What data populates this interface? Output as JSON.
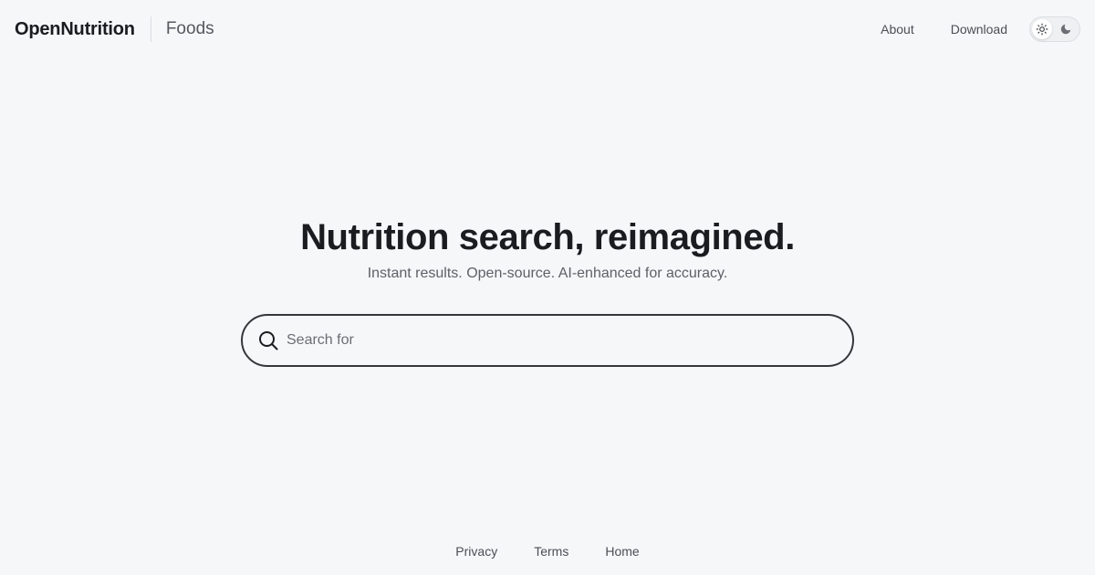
{
  "header": {
    "brand": "OpenNutrition",
    "section": "Foods",
    "nav": [
      {
        "label": "About"
      },
      {
        "label": "Download"
      }
    ],
    "theme_toggle": {
      "options": [
        "sun-icon",
        "moon-icon"
      ],
      "active": "sun-icon"
    }
  },
  "hero": {
    "headline": "Nutrition search, reimagined.",
    "subhead": "Instant results. Open-source. AI-enhanced for accuracy."
  },
  "search": {
    "icon": "search-icon",
    "placeholder": "Search for",
    "value": ""
  },
  "footer": {
    "links": [
      {
        "label": "Privacy"
      },
      {
        "label": "Terms"
      },
      {
        "label": "Home"
      }
    ]
  },
  "colors": {
    "background": "#f6f7f9",
    "text": "#1b1c1f",
    "muted": "#5d6066",
    "border": "#34363a"
  }
}
